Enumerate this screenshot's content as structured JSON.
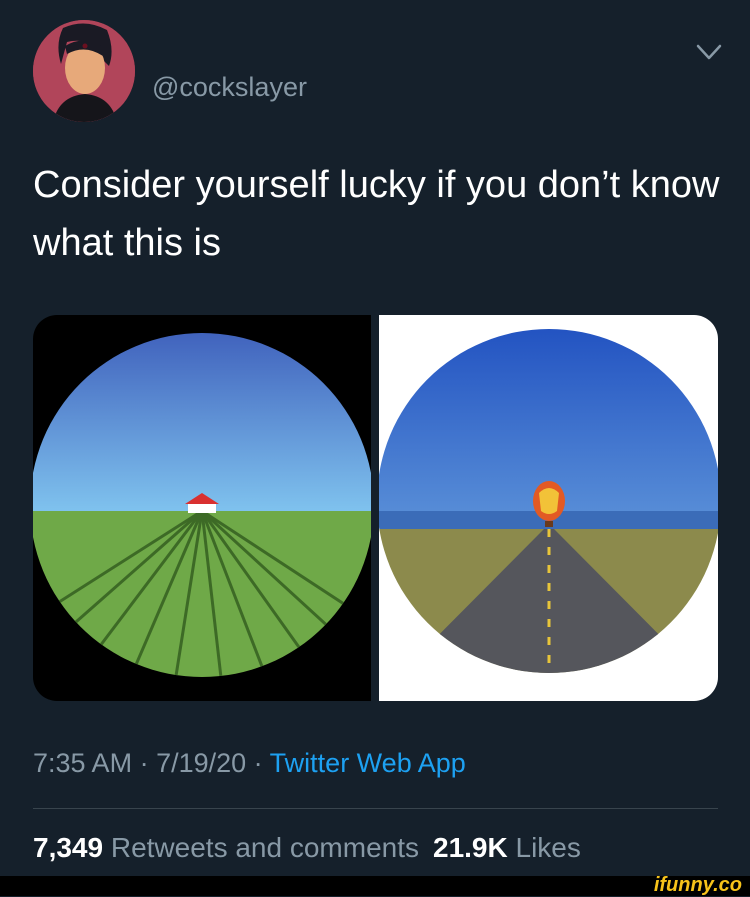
{
  "user": {
    "handle": "@cockslayer"
  },
  "tweet": {
    "text": "Consider yourself lucky if you don’t know what this is"
  },
  "meta": {
    "time": "7:35 AM",
    "sep1": " · ",
    "date": "7/19/20",
    "sep2": " · ",
    "source": "Twitter Web App"
  },
  "stats": {
    "retweets_count": "7,349",
    "retweets_label": "Retweets and comments",
    "likes_count": "21.9K",
    "likes_label": "Likes"
  },
  "footer": {
    "watermark": "ifunny.co"
  },
  "icons": {
    "menu": "chevron-down-icon"
  },
  "colors": {
    "background": "#15202b",
    "link": "#1da1f2",
    "secondary_text": "#8899a6",
    "divider": "#38444d"
  }
}
